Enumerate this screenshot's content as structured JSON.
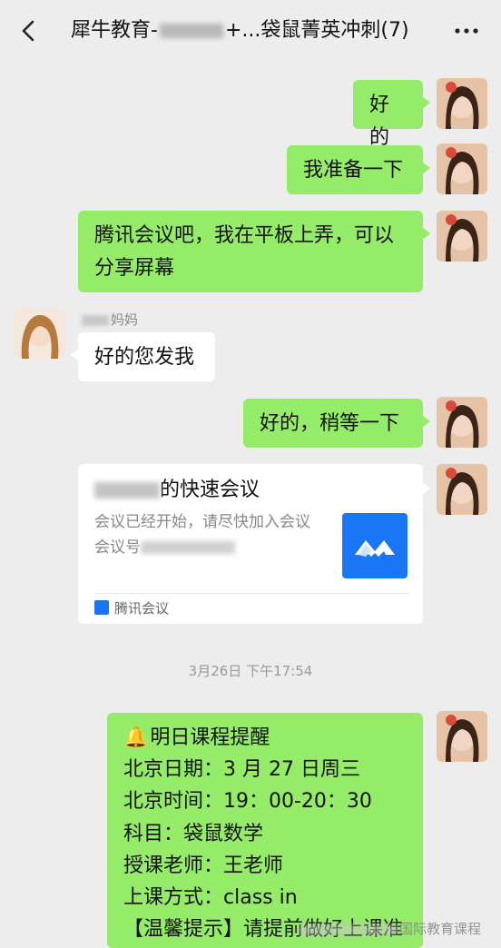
{
  "header": {
    "title_prefix": "犀牛教育-",
    "title_suffix": "+...袋鼠菁英冲刺(7)"
  },
  "messages": [
    {
      "text": "好的"
    },
    {
      "text": "我准备一下"
    },
    {
      "text": "腾讯会议吧，我在平板上弄，可以分享屏幕"
    },
    {
      "sender": "妈妈",
      "text": "好的您发我"
    },
    {
      "text": "好的，稍等一下"
    }
  ],
  "meeting_card": {
    "title_suffix": "的快速会议",
    "desc_line": "会议已经开始，请尽快加入会议",
    "id_label": "会议号",
    "app_name": "腾讯会议"
  },
  "timestamp": "3月26日 下午17:54",
  "reminder": {
    "title": "明日课程提醒",
    "date_line": "北京日期：3 月 27 日周三",
    "time_line": "北京时间：19：00-20：30",
    "subject_line": "科目：袋鼠数学",
    "teacher_line": "授课老师：王老师",
    "method_line": "上课方式：class in",
    "tip_line": "【温馨提示】请提前做好上课准"
  },
  "watermark": "国际教育课程",
  "colors": {
    "bubble_green": "#95ec69",
    "background": "#ededed",
    "tencent_blue": "#1976f5"
  }
}
